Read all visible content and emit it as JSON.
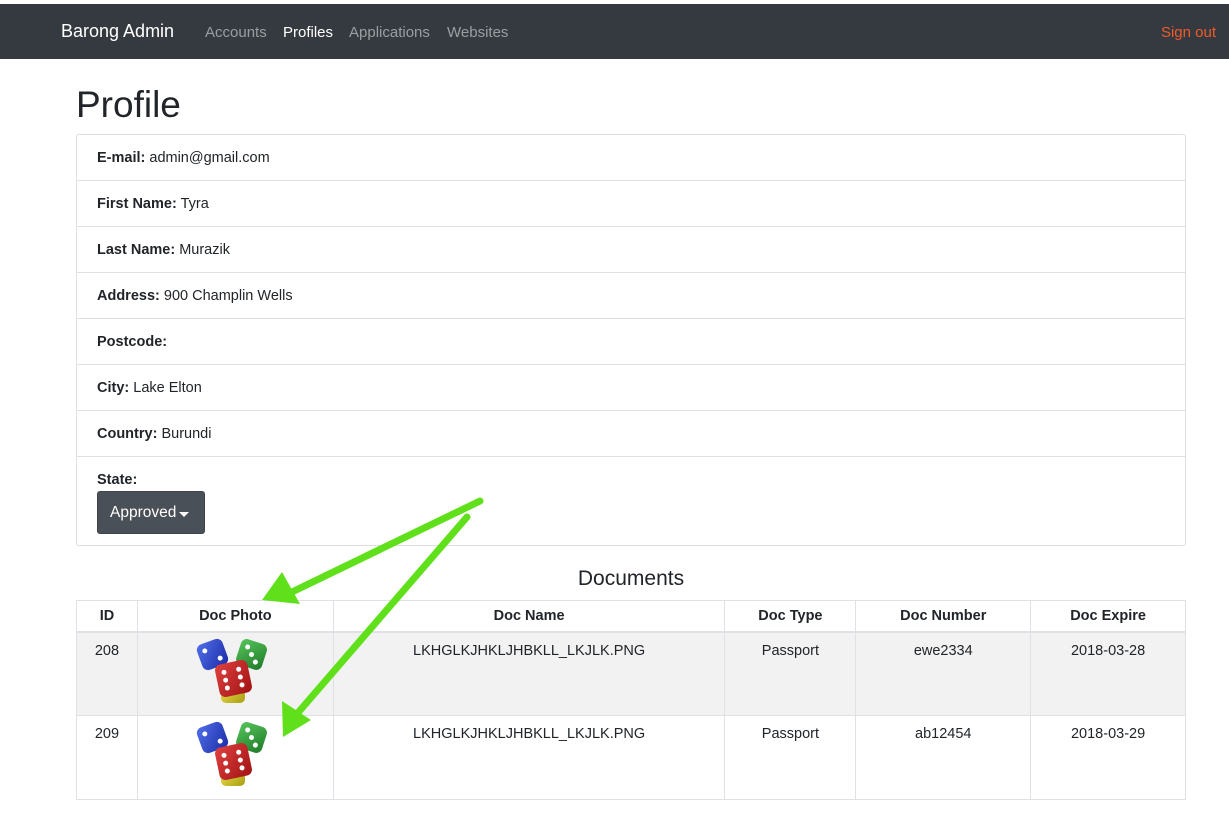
{
  "navbar": {
    "brand": "Barong Admin",
    "links": [
      "Accounts",
      "Profiles",
      "Applications",
      "Websites"
    ],
    "active_link": "Profiles",
    "signout": "Sign out",
    "signout_color": "#f15a29"
  },
  "page": {
    "title": "Profile"
  },
  "profile": {
    "fields": [
      {
        "label": "E-mail:",
        "value": "admin@gmail.com"
      },
      {
        "label": "First Name:",
        "value": "Tyra"
      },
      {
        "label": "Last Name:",
        "value": "Murazik"
      },
      {
        "label": "Address:",
        "value": "900 Champlin Wells"
      },
      {
        "label": "Postcode:",
        "value": ""
      },
      {
        "label": "City:",
        "value": "Lake Elton"
      },
      {
        "label": "Country:",
        "value": "Burundi"
      }
    ],
    "state_label": "State:",
    "state_value": "Approved"
  },
  "documents": {
    "title": "Documents",
    "headers": [
      "ID",
      "Doc Photo",
      "Doc Name",
      "Doc Type",
      "Doc Number",
      "Doc Expire"
    ],
    "rows": [
      {
        "id": "208",
        "photo_icon": "dice-icon",
        "name": "LKHGLKJHKLJHBKLL_LKJLK.PNG",
        "type": "Passport",
        "number": "ewe2334",
        "expire": "2018-03-28"
      },
      {
        "id": "209",
        "photo_icon": "dice-icon",
        "name": "LKHGLKJHKLJHBKLL_LKJLK.PNG",
        "type": "Passport",
        "number": "ab12454",
        "expire": "2018-03-29"
      }
    ]
  },
  "annotation_color": "#5fe01a"
}
